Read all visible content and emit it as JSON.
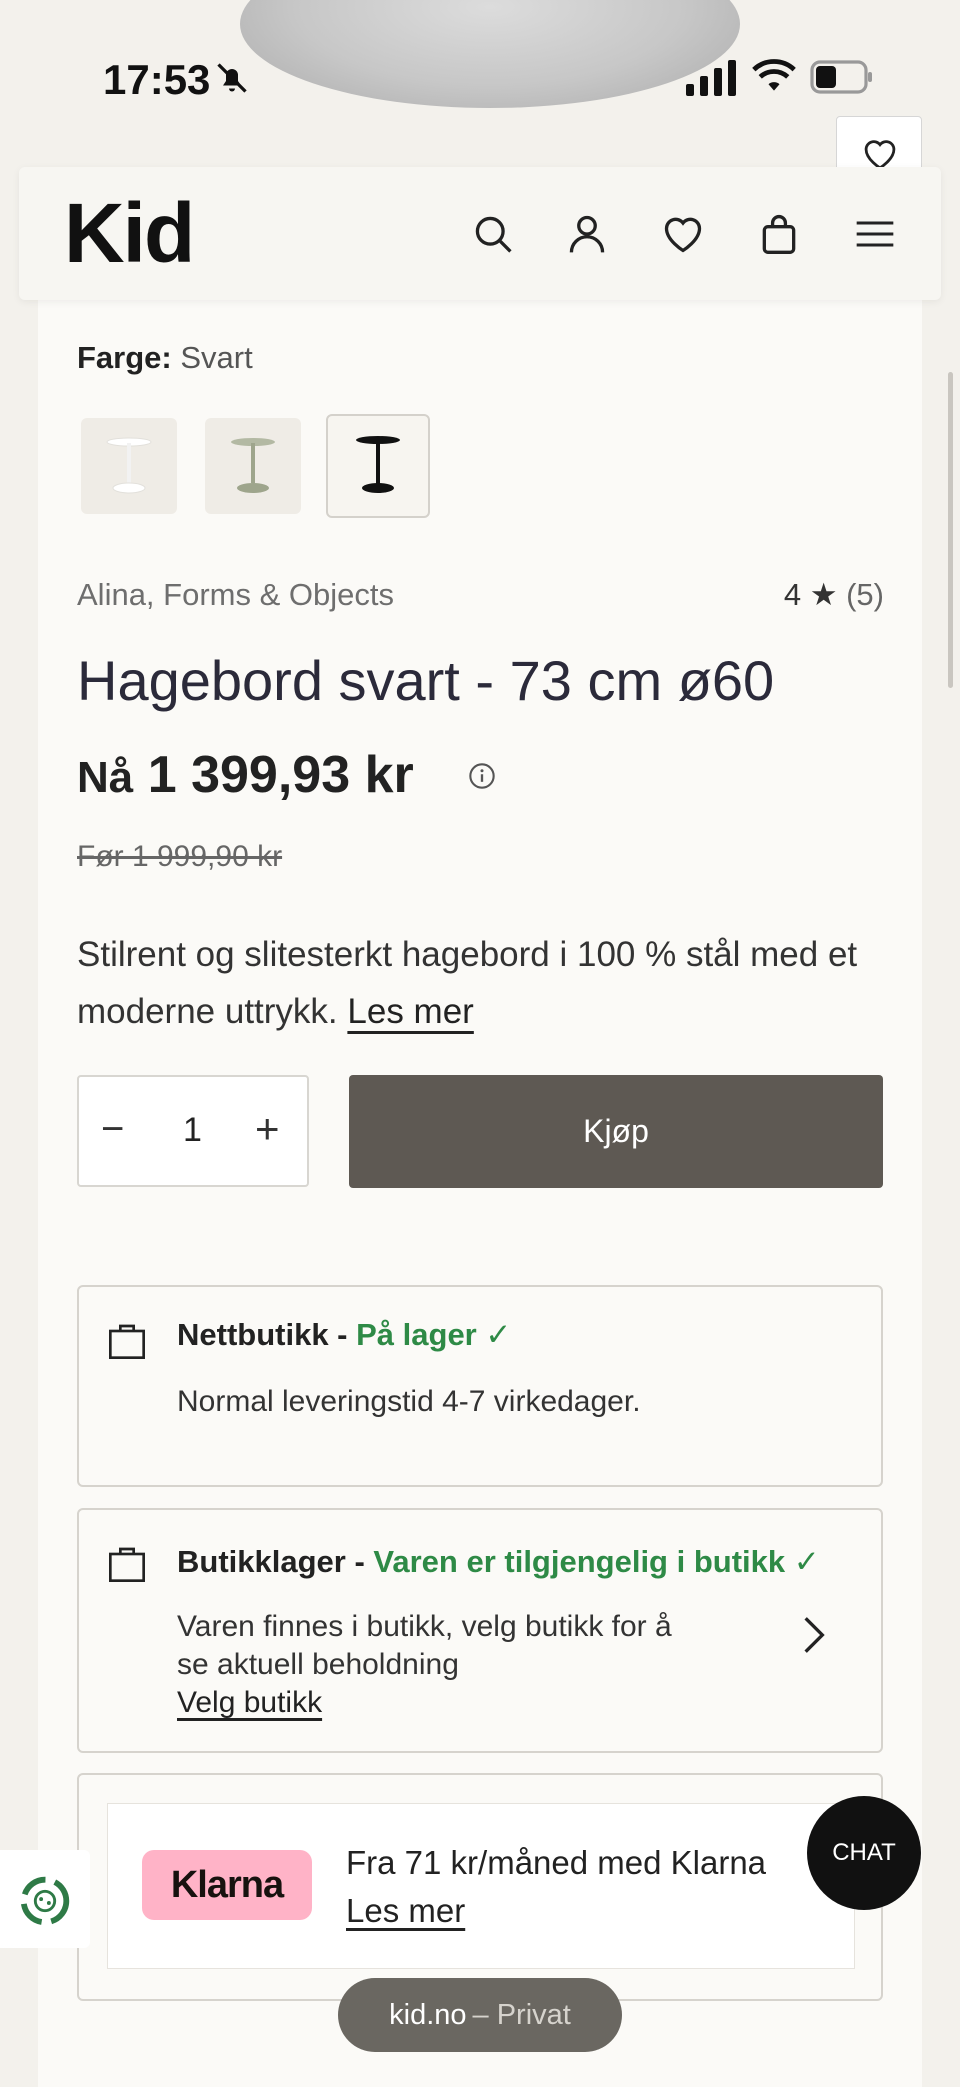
{
  "status_bar": {
    "time": "17:53"
  },
  "header": {
    "logo": "Kid"
  },
  "product": {
    "color_label": "Farge:",
    "color_value": "Svart",
    "brand": "Alina, Forms & Objects",
    "rating_value": "4",
    "rating_star": "★",
    "rating_count": "(5)",
    "title": "Hagebord svart - 73 cm ø60",
    "price_prefix": "Nå",
    "price_now": "1 399,93 kr",
    "price_before": "Før 1 999,90 kr",
    "description": "Stilrent og slitesterkt hagebord i 100 % stål med et moderne uttrykk.",
    "read_more": "Les mer",
    "quantity": "1",
    "qty_minus": "−",
    "qty_plus": "+",
    "buy_label": "Kjøp"
  },
  "stock": {
    "online_title": "Nettbutikk -",
    "online_status": "På lager ✓",
    "online_text": "Normal leveringstid 4-7 virkedager.",
    "store_title": "Butikklager -",
    "store_status": "Varen er tilgjengelig i butikk ✓",
    "store_text_1": "Varen finnes i butikk, velg butikk for å",
    "store_text_2": "se aktuell beholdning",
    "store_link": "Velg butikk"
  },
  "klarna": {
    "logo": "Klarna",
    "text": "Fra 71 kr/måned med Klarna",
    "link": "Les mer"
  },
  "chat_label": "CHAT",
  "url_bar": {
    "domain": "kid.no",
    "mode": "– Privat"
  },
  "colors": {
    "buy": "#5e5953",
    "ok_green": "#2e8a46",
    "klarna_pink": "#ffb3c7"
  }
}
